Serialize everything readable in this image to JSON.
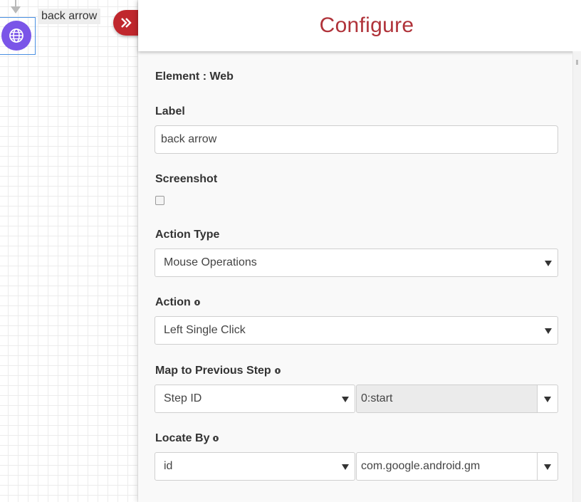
{
  "canvas": {
    "node_label": "back arrow",
    "node_icon": "globe-icon",
    "node_color": "#7a55e8"
  },
  "panel": {
    "title": "Configure",
    "title_color": "#b0333a",
    "collapse_icon": "double-chevron-right-icon",
    "element_line": "Element : Web",
    "label_field": {
      "label": "Label",
      "value": "back arrow"
    },
    "screenshot": {
      "label": "Screenshot",
      "checked": false
    },
    "action_type": {
      "label": "Action Type",
      "value": "Mouse Operations"
    },
    "action": {
      "label": "Action",
      "value": "Left Single Click"
    },
    "map_prev": {
      "label": "Map to Previous Step",
      "select_value": "Step ID",
      "combo_value": "0:start"
    },
    "locate_by": {
      "label": "Locate By",
      "select_value": "id",
      "combo_value": "com.google.android.gm"
    }
  }
}
